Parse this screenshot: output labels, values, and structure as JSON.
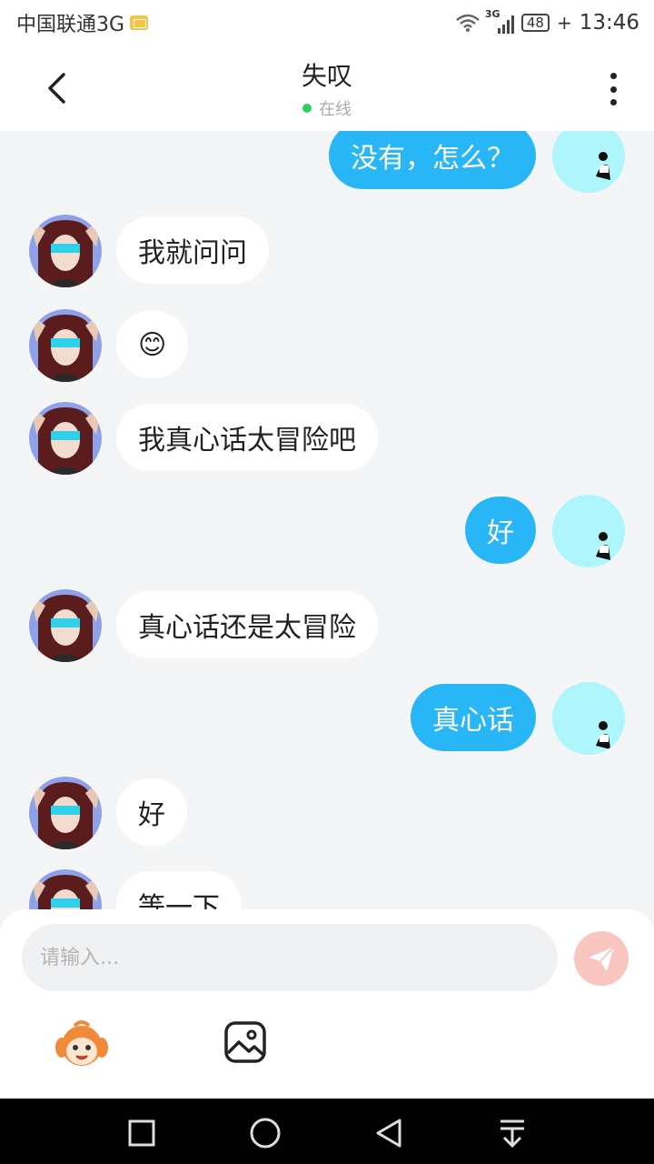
{
  "status_bar": {
    "carrier": "中国联通3G",
    "network": "3G",
    "battery": "48",
    "time": "13:46"
  },
  "header": {
    "title": "失叹",
    "status": "在线"
  },
  "messages": [
    {
      "side": "out",
      "text": "没有，怎么？"
    },
    {
      "side": "in",
      "text": "我就问问"
    },
    {
      "side": "in",
      "text": "😊"
    },
    {
      "side": "in",
      "text": "我真心话太冒险吧"
    },
    {
      "side": "out",
      "text": "好"
    },
    {
      "side": "in",
      "text": "真心话还是太冒险"
    },
    {
      "side": "out",
      "text": "真心话"
    },
    {
      "side": "in",
      "text": "好"
    },
    {
      "side": "in",
      "text": "等一下"
    }
  ],
  "composer": {
    "placeholder": "请输入..."
  },
  "icons": {
    "back": "chevron-left-icon",
    "more": "more-vertical-icon",
    "send": "send-icon",
    "emoji": "emoji-face-icon",
    "image": "image-icon"
  },
  "colors": {
    "outgoing_bubble": "#29b6f6",
    "incoming_bubble": "#ffffff",
    "send_button": "#f9c6c0",
    "online": "#2fcf60"
  }
}
